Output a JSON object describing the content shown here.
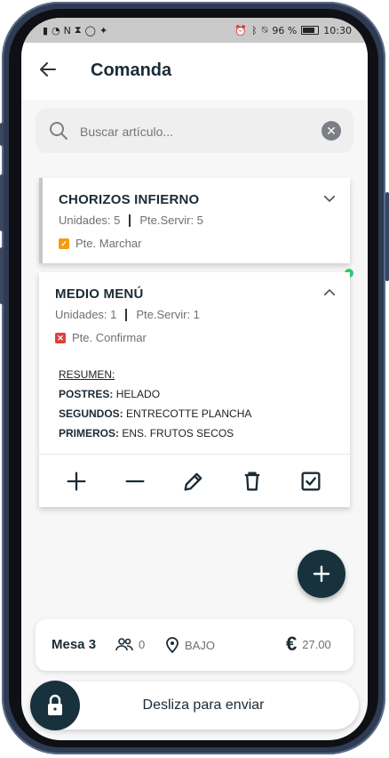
{
  "status_bar": {
    "battery": "96 %",
    "time": "10:30"
  },
  "header": {
    "title": "Comanda"
  },
  "search": {
    "placeholder": "Buscar artículo..."
  },
  "orders": [
    {
      "name": "CHORIZOS INFIERNO",
      "units": "Unidades: 5",
      "pending": "Pte.Servir: 5",
      "status": "Pte. Marchar",
      "status_color": "#f39c12",
      "expanded": false
    },
    {
      "name": "MEDIO MENÚ",
      "units": "Unidades: 1",
      "pending": "Pte.Servir: 1",
      "status": "Pte. Confirmar",
      "status_color": "#d9423c",
      "expanded": true,
      "summary": {
        "heading": "RESUMEN:",
        "rows": [
          {
            "key": "POSTRES:",
            "value": "HELADO"
          },
          {
            "key": "SEGUNDOS:",
            "value": "ENTRECOTTE PLANCHA"
          },
          {
            "key": "PRIMEROS:",
            "value": "ENS. FRUTOS SECOS"
          }
        ]
      }
    }
  ],
  "bottom": {
    "table": "Mesa 3",
    "guests": "0",
    "location": "BAJO",
    "total": "27.00"
  },
  "send": {
    "label": "Desliza para enviar"
  },
  "colors": {
    "primary": "#17323d",
    "accent_online": "#2ecc71"
  }
}
